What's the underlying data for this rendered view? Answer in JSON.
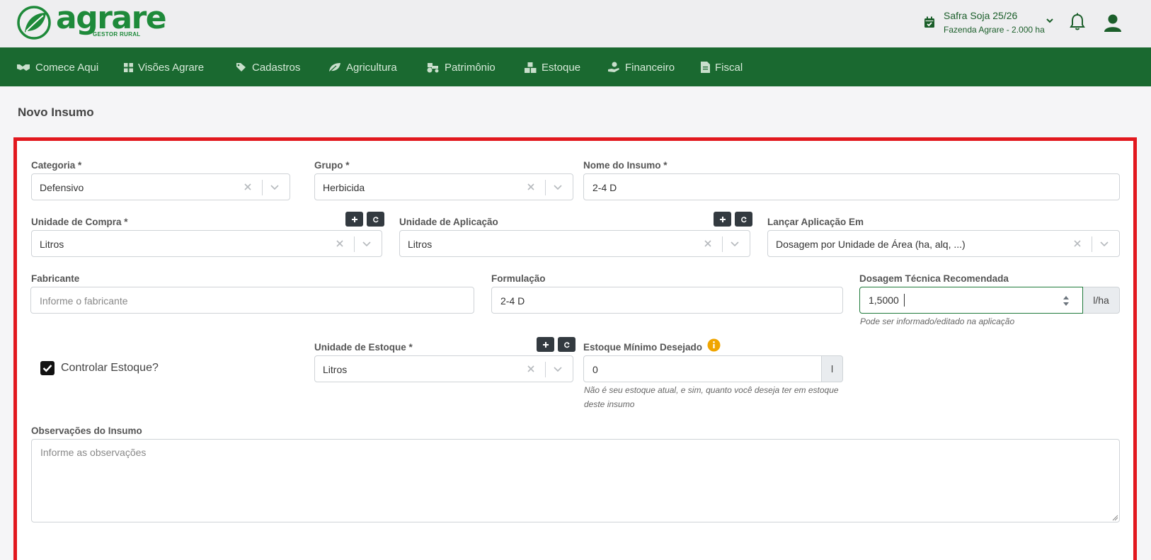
{
  "header": {
    "logo_text": "agrare",
    "logo_subtitle": "GESTOR RURAL",
    "season_title": "Safra Soja 25/26",
    "season_farm": "Fazenda Agrare - 2.000 ha"
  },
  "nav": [
    {
      "label": "Comece Aqui",
      "icon": "handshake-icon"
    },
    {
      "label": "Visões Agrare",
      "icon": "grid-icon"
    },
    {
      "label": "Cadastros",
      "icon": "tags-icon"
    },
    {
      "label": "Agricultura",
      "icon": "leaf-icon"
    },
    {
      "label": "Patrimônio",
      "icon": "tractor-icon"
    },
    {
      "label": "Estoque",
      "icon": "boxes-icon"
    },
    {
      "label": "Financeiro",
      "icon": "hand-coin-icon"
    },
    {
      "label": "Fiscal",
      "icon": "invoice-icon"
    }
  ],
  "page": {
    "title": "Novo Insumo"
  },
  "form": {
    "categoria": {
      "label": "Categoria *",
      "value": "Defensivo"
    },
    "grupo": {
      "label": "Grupo *",
      "value": "Herbicida"
    },
    "nome": {
      "label": "Nome do Insumo *",
      "value": "2-4 D"
    },
    "unidade_compra": {
      "label": "Unidade de Compra *",
      "value": "Litros"
    },
    "unidade_aplicacao": {
      "label": "Unidade de Aplicação",
      "value": "Litros"
    },
    "lancar_aplicacao": {
      "label": "Lançar Aplicação Em",
      "value": "Dosagem por Unidade de Área (ha, alq, ...)"
    },
    "fabricante": {
      "label": "Fabricante",
      "placeholder": "Informe o fabricante"
    },
    "formulacao": {
      "label": "Formulação",
      "value": "2-4 D"
    },
    "dosagem": {
      "label": "Dosagem Técnica Recomendada",
      "value": "1,5000",
      "unit": "l/ha",
      "help": "Pode ser informado/editado na aplicação"
    },
    "controlar_estoque": {
      "label": "Controlar Estoque?",
      "checked": true
    },
    "unidade_estoque": {
      "label": "Unidade de Estoque *",
      "value": "Litros"
    },
    "estoque_minimo": {
      "label": "Estoque Mínimo Desejado",
      "value": "0",
      "unit": "l",
      "help_line1": "Não é seu estoque atual, e sim, quanto você deseja ter em estoque",
      "help_line2": "deste insumo"
    },
    "observacoes": {
      "label": "Observações do Insumo",
      "placeholder": "Informe as observações"
    }
  },
  "colors": {
    "brand_green": "#1a6930",
    "highlight_border": "#e2181e",
    "info_icon": "#f0a500"
  }
}
